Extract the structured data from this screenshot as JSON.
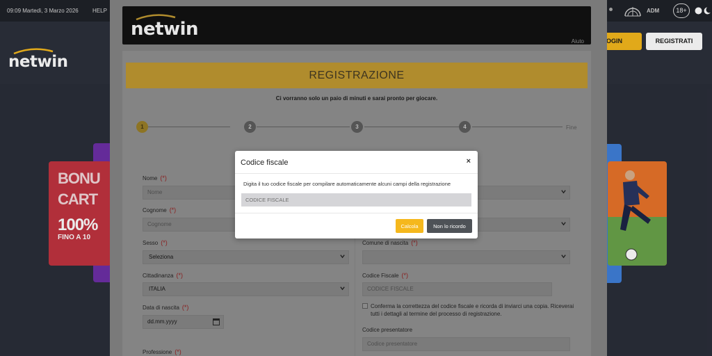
{
  "topbar": {
    "datetime": "09:09 Martedì, 3 Marzo 2026",
    "help": "HELP",
    "adm": "ADM",
    "age_badge": "18+"
  },
  "site": {
    "logo": "netwin",
    "login_label": "LOGIN",
    "register_label": "REGISTRATI"
  },
  "promo_left": {
    "line1": "BONU",
    "line2": "CART",
    "line3": "100%",
    "line4": "FINO A 10"
  },
  "registration": {
    "logo": "netwin",
    "help_link": "Aiuto",
    "title": "REGISTRAZIONE",
    "subtitle": "Ci vorranno solo un paio di minuti e sarai pronto per giocare.",
    "steps": [
      "1",
      "2",
      "3",
      "4"
    ],
    "end_step": "Fine",
    "required_mark": "(*)",
    "fields": {
      "nome": {
        "label": "Nome",
        "placeholder": "Nome"
      },
      "cognome": {
        "label": "Cognome",
        "placeholder": "Cognome"
      },
      "sesso": {
        "label": "Sesso",
        "value": "Seleziona"
      },
      "cittadinanza": {
        "label": "Cittadinanza",
        "value": "ITALIA"
      },
      "data_nascita": {
        "label": "Data di nascita",
        "value": "dd.mm.yyyy"
      },
      "professione": {
        "label": "Professione"
      },
      "comune_nascita": {
        "label": "Comune di nascita",
        "value": ""
      },
      "codice_fiscale": {
        "label": "Codice Fiscale",
        "placeholder": "CODICE FISCALE"
      },
      "conferma_cf": "Conferma la correttezza del codice fiscale e ricorda di inviarci una copia. Riceverai tutti i dettagli al termine del processo di registrazione.",
      "codice_presentatore": {
        "label": "Codice presentatore",
        "placeholder": "Codice presentatore"
      }
    }
  },
  "modal": {
    "title": "Codice fiscale",
    "close": "×",
    "description": "Digita il tuo codice fiscale per compilare automaticamente alcuni campi della registrazione",
    "input_placeholder": "CODICE FISCALE",
    "btn_calcola": "Calcola",
    "btn_no_ricordo": "Non lo ricordo"
  },
  "colors": {
    "accent": "#f5b81d",
    "dark_button": "#4e5257",
    "background": "#2b2f3a"
  }
}
